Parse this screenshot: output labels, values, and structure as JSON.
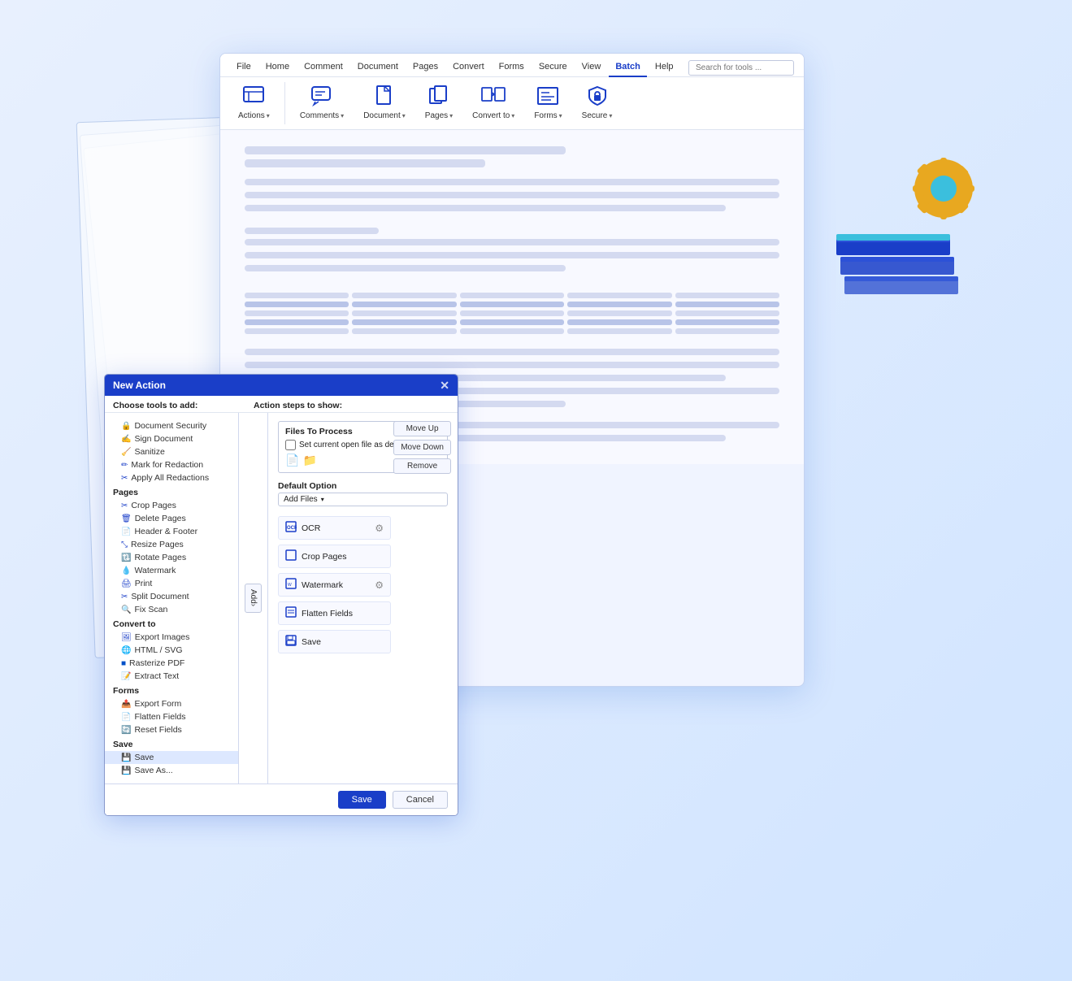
{
  "ribbon": {
    "tabs": [
      {
        "label": "File",
        "active": false
      },
      {
        "label": "Home",
        "active": false
      },
      {
        "label": "Comment",
        "active": false
      },
      {
        "label": "Document",
        "active": false
      },
      {
        "label": "Pages",
        "active": false
      },
      {
        "label": "Convert",
        "active": false
      },
      {
        "label": "Forms",
        "active": false
      },
      {
        "label": "Secure",
        "active": false
      },
      {
        "label": "View",
        "active": false
      },
      {
        "label": "Batch",
        "active": true
      },
      {
        "label": "Help",
        "active": false
      }
    ],
    "search_placeholder": "Search for tools ...",
    "tools": [
      {
        "label": "Actions",
        "icon": "⬛"
      },
      {
        "label": "Comments",
        "icon": "💬"
      },
      {
        "label": "Document",
        "icon": "📄"
      },
      {
        "label": "Pages",
        "icon": "📋"
      },
      {
        "label": "Convert to",
        "icon": "🔄"
      },
      {
        "label": "Forms",
        "icon": "📝"
      },
      {
        "label": "Secure",
        "icon": "🔒"
      }
    ]
  },
  "dialog": {
    "title": "New Action",
    "left_panel_label": "Choose tools to add:",
    "right_panel_label": "Action steps to show:",
    "sections": [
      {
        "header": "",
        "items": [
          {
            "label": "Document Security",
            "icon": "🔒"
          },
          {
            "label": "Sign Document",
            "icon": "✍️"
          },
          {
            "label": "Sanitize",
            "icon": "🧹"
          },
          {
            "label": "Mark for Redaction",
            "icon": "✏️"
          },
          {
            "label": "Apply All Redactions",
            "icon": "✂️"
          }
        ]
      },
      {
        "header": "Pages",
        "items": [
          {
            "label": "Crop Pages",
            "icon": "✂️"
          },
          {
            "label": "Delete Pages",
            "icon": "🗑️"
          },
          {
            "label": "Header & Footer",
            "icon": "📄"
          },
          {
            "label": "Resize Pages",
            "icon": "⤡"
          },
          {
            "label": "Rotate Pages",
            "icon": "🔃"
          },
          {
            "label": "Watermark",
            "icon": "💧"
          },
          {
            "label": "Print",
            "icon": "🖨️"
          },
          {
            "label": "Split Document",
            "icon": "✂️"
          },
          {
            "label": "Fix Scan",
            "icon": "🔍"
          }
        ]
      },
      {
        "header": "Convert to",
        "items": [
          {
            "label": "Export Images",
            "icon": "🖼️"
          },
          {
            "label": "HTML / SVG",
            "icon": "🌐"
          },
          {
            "label": "Rasterize PDF",
            "icon": "🗒️"
          },
          {
            "label": "Extract Text",
            "icon": "📝"
          }
        ]
      },
      {
        "header": "Forms",
        "items": [
          {
            "label": "Export Form",
            "icon": "📤"
          },
          {
            "label": "Flatten Fields",
            "icon": "📄"
          },
          {
            "label": "Reset Fields",
            "icon": "🔄"
          }
        ]
      },
      {
        "header": "Save",
        "items": [
          {
            "label": "Save",
            "icon": "💾",
            "selected": true
          },
          {
            "label": "Save As...",
            "icon": "💾"
          }
        ]
      }
    ],
    "files_to_process": "Files To Process",
    "set_current": "Set current open file as default",
    "default_option_label": "Default Option",
    "default_option_value": "Add Files",
    "steps": [
      {
        "label": "OCR",
        "has_settings": true
      },
      {
        "label": "Crop Pages",
        "has_settings": false
      },
      {
        "label": "Watermark",
        "has_settings": true
      },
      {
        "label": "Flatten Fields",
        "has_settings": false
      },
      {
        "label": "Save",
        "has_settings": false
      }
    ],
    "side_buttons": [
      "Move Up",
      "Move Down",
      "Remove"
    ],
    "add_button": "Add›",
    "footer_buttons": [
      "Save",
      "Cancel"
    ]
  },
  "colors": {
    "accent": "#1a3ec8",
    "gear_yellow": "#e8a820",
    "gear_center": "#3bbfdd",
    "book_blue1": "#1a3ec8",
    "book_blue2": "#2250dd",
    "book_blue3": "#3060ee",
    "book_teal": "#3bbfdd"
  }
}
